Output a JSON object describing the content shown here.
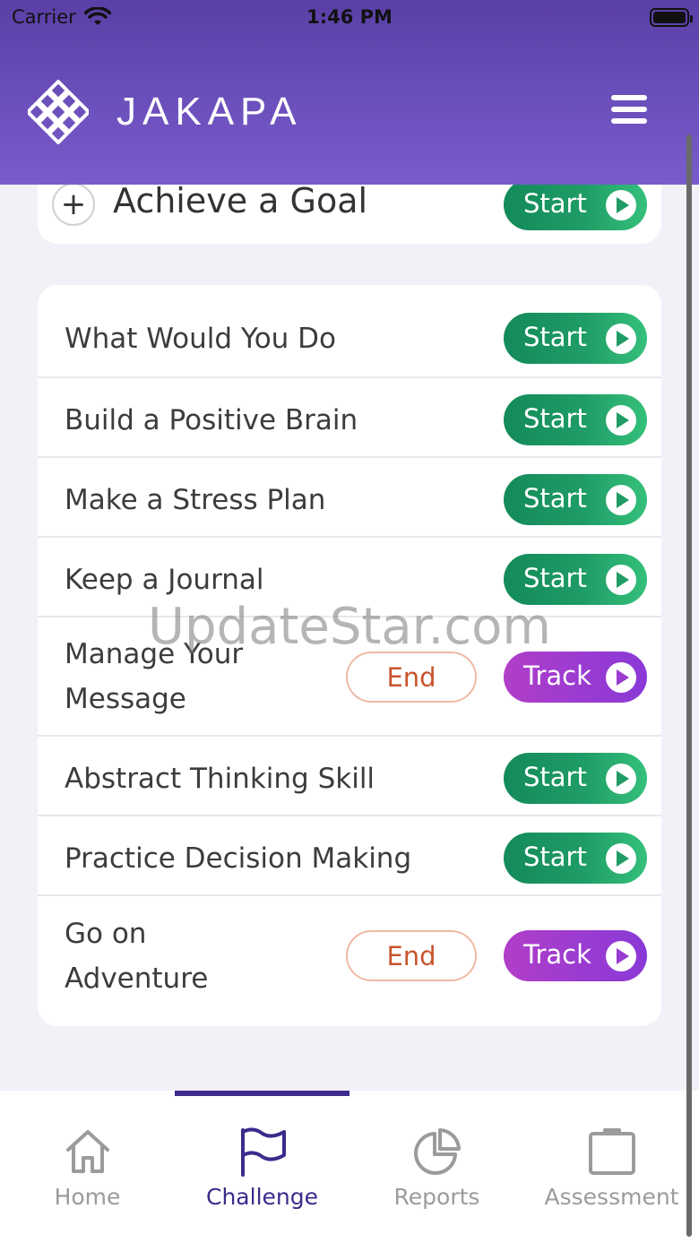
{
  "status_bar": {
    "carrier": "Carrier",
    "time": "1:46 PM"
  },
  "header": {
    "app_name": "JAKAPA",
    "logo_icon": "lattice-diamond-logo",
    "menu_icon": "hamburger-menu-icon"
  },
  "goal_card": {
    "label": "Achieve a Goal",
    "button_label": "Start"
  },
  "activities": [
    {
      "label": "What Would You Do",
      "action": "Start"
    },
    {
      "label": "Build a Positive Brain",
      "action": "Start"
    },
    {
      "label": "Make a Stress Plan",
      "action": "Start"
    },
    {
      "label": "Keep a Journal",
      "action": "Start"
    },
    {
      "label": "Manage Your Message",
      "action": "Track",
      "end_label": "End"
    },
    {
      "label": "Abstract Thinking Skill",
      "action": "Start"
    },
    {
      "label": "Practice Decision Making",
      "action": "Start"
    },
    {
      "label": "Go on Adventure",
      "action": "Track",
      "end_label": "End"
    }
  ],
  "watermark": "UpdateStar.com",
  "tabs": [
    {
      "label": "Home",
      "icon": "home-icon",
      "active": false
    },
    {
      "label": "Challenge",
      "icon": "flag-icon",
      "active": true
    },
    {
      "label": "Reports",
      "icon": "pie-chart-icon",
      "active": false
    },
    {
      "label": "Assessment",
      "icon": "clipboard-icon",
      "active": false
    }
  ],
  "colors": {
    "header": "#6b4fbb",
    "start_button": "#1f9c66",
    "track_button": "#9a3bd1",
    "end_button_text": "#c8542c",
    "active_tab": "#3d2a8c"
  }
}
